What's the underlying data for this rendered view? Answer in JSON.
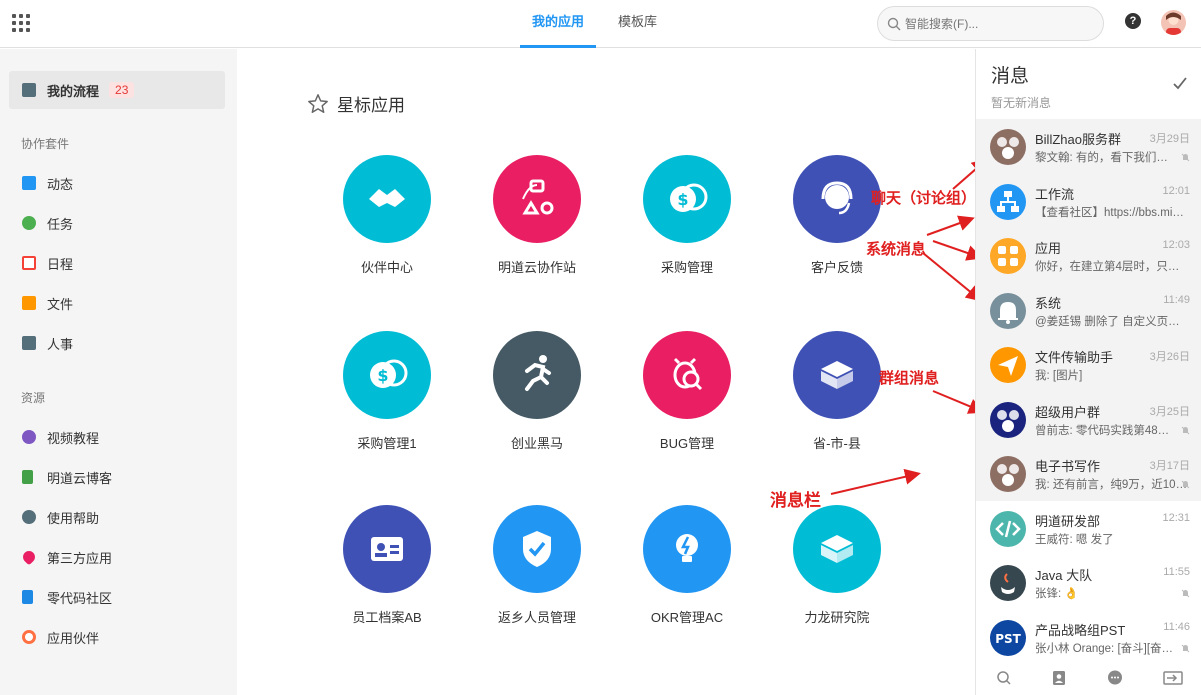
{
  "header": {
    "tabs": [
      {
        "label": "我的应用"
      },
      {
        "label": "模板库"
      }
    ],
    "search_placeholder": "智能搜索(F)...",
    "help_label": "?"
  },
  "sidebar": {
    "my_flow": {
      "label": "我的流程",
      "count": "23"
    },
    "suite_heading": "协作套件",
    "suite_items": [
      {
        "label": "动态",
        "icon": "feed-icon",
        "color": "#2196f3"
      },
      {
        "label": "任务",
        "icon": "task-check-icon",
        "color": "#4caf50"
      },
      {
        "label": "日程",
        "icon": "calendar-icon",
        "color": "#f44336"
      },
      {
        "label": "文件",
        "icon": "cloud-folder-icon",
        "color": "#ff9800"
      },
      {
        "label": "人事",
        "icon": "hr-icon",
        "color": "#546e7a"
      }
    ],
    "resource_heading": "资源",
    "resource_items": [
      {
        "label": "视频教程",
        "icon": "play-icon",
        "color": "#7e57c2"
      },
      {
        "label": "明道云博客",
        "icon": "blog-icon",
        "color": "#43a047"
      },
      {
        "label": "使用帮助",
        "icon": "help-icon",
        "color": "#546e7a"
      },
      {
        "label": "第三方应用",
        "icon": "heart-icon",
        "color": "#e91e63"
      },
      {
        "label": "零代码社区",
        "icon": "community-icon",
        "color": "#1e88e5"
      },
      {
        "label": "应用伙伴",
        "icon": "partner-icon",
        "color": "#ff7043"
      }
    ]
  },
  "main": {
    "starred_title": "星标应用",
    "apps": [
      {
        "label": "伙伴中心",
        "color": "#00bcd4",
        "icon": "handshake-icon"
      },
      {
        "label": "明道云协作站",
        "color": "#e91e63",
        "icon": "nodes-icon"
      },
      {
        "label": "采购管理",
        "color": "#00bcd4",
        "icon": "coins-icon"
      },
      {
        "label": "客户反馈",
        "color": "#3f51b5",
        "icon": "headset-icon"
      },
      {
        "label": "采购管理1",
        "color": "#00bcd4",
        "icon": "coins-icon"
      },
      {
        "label": "创业黑马",
        "color": "#455a64",
        "icon": "runner-icon"
      },
      {
        "label": "BUG管理",
        "color": "#e91e63",
        "icon": "bug-search-icon"
      },
      {
        "label": "省-市-县",
        "color": "#3f51b5",
        "icon": "brick-icon"
      },
      {
        "label": "员工档案AB",
        "color": "#3f51b5",
        "icon": "id-card-icon"
      },
      {
        "label": "返乡人员管理",
        "color": "#2196f3",
        "icon": "shield-check-icon"
      },
      {
        "label": "OKR管理AC",
        "color": "#2196f3",
        "icon": "bulb-icon"
      },
      {
        "label": "力龙研究院",
        "color": "#00bcd4",
        "icon": "brick-icon"
      }
    ],
    "annotations": {
      "chat": "聊天（讨论组）",
      "system": "系统消息",
      "group": "群组消息",
      "bar": "消息栏"
    }
  },
  "messages": {
    "title": "消息",
    "subtitle": "暂无新消息",
    "items": [
      {
        "name": "BillZhao服务群",
        "time": "3月29日",
        "preview": "黎文翰: 有的，看下我们…",
        "avatar_color": "#8d6e63",
        "grey": true,
        "muted": true,
        "icon": "group-avatar-icon"
      },
      {
        "name": "工作流",
        "time": "12:01",
        "preview": "【查看社区】https://bbs.mi…",
        "avatar_color": "#2196f3",
        "grey": true,
        "muted": false,
        "icon": "workflow-icon"
      },
      {
        "name": "应用",
        "time": "12:03",
        "preview": "你好，在建立第4层时，只…",
        "avatar_color": "#ffa726",
        "grey": true,
        "muted": false,
        "icon": "apps-icon"
      },
      {
        "name": "系统",
        "time": "11:49",
        "preview": "@姜廷锡 删除了 自定义页…",
        "avatar_color": "#78909c",
        "grey": true,
        "muted": false,
        "icon": "bell-icon"
      },
      {
        "name": "文件传输助手",
        "time": "3月26日",
        "preview": "我: [图片]",
        "avatar_color": "#ff9800",
        "grey": true,
        "muted": false,
        "icon": "send-icon"
      },
      {
        "name": "超级用户群",
        "time": "3月25日",
        "preview": "曾前志: 零代码实践第48…",
        "avatar_color": "#1a237e",
        "grey": true,
        "muted": true,
        "icon": "group-avatar-icon"
      },
      {
        "name": "电子书写作",
        "time": "3月17日",
        "preview": "我: 还有前言，纯9万，近10…",
        "avatar_color": "#8d6e63",
        "grey": true,
        "muted": true,
        "icon": "group-avatar-icon"
      },
      {
        "name": "明道研发部",
        "time": "12:31",
        "preview": "王威符: 嗯 发了",
        "avatar_color": "#4db6ac",
        "grey": false,
        "muted": false,
        "icon": "code-icon"
      },
      {
        "name": "Java 大队",
        "time": "11:55",
        "preview": "张锋: 👌",
        "avatar_color": "#37474f",
        "grey": false,
        "muted": true,
        "icon": "java-icon"
      },
      {
        "name": "产品战略组PST",
        "time": "11:46",
        "preview": "张小林 Orange: [奋斗][奋…",
        "avatar_color": "#0d47a1",
        "grey": false,
        "muted": true,
        "icon": "pst-icon"
      }
    ],
    "footer_icons": [
      "search-icon",
      "contacts-icon",
      "chat-icon",
      "collapse-icon"
    ]
  }
}
